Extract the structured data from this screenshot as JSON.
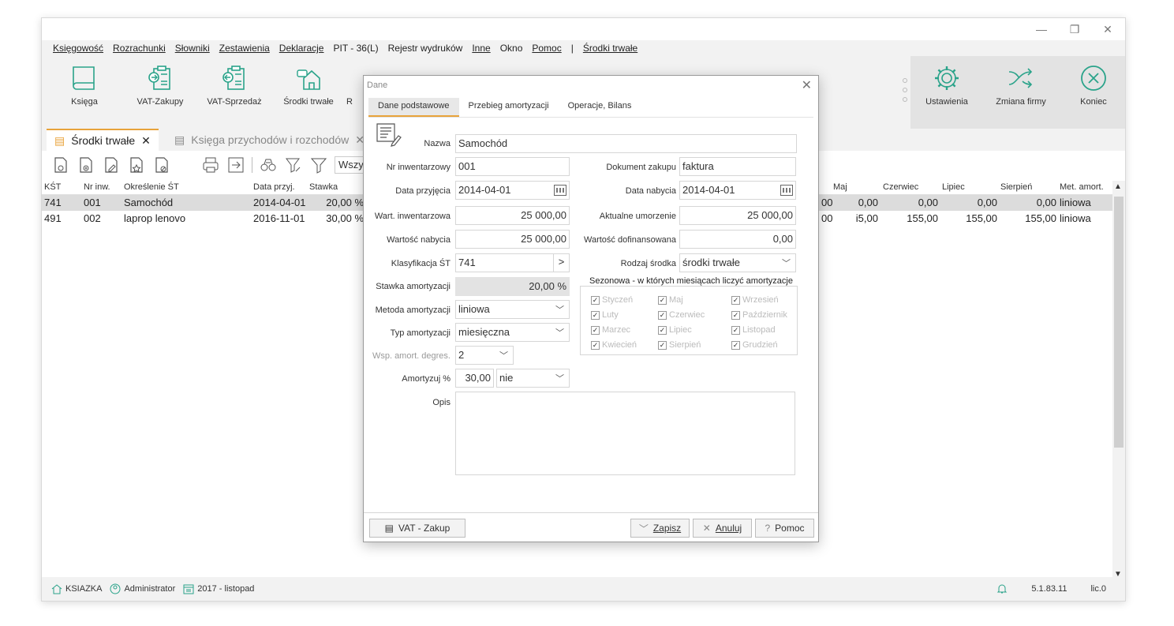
{
  "window_controls": {
    "minimize": "—",
    "restore": "❐",
    "close": "✕"
  },
  "menu": [
    "Księgowość",
    "Rozrachunki",
    "Słowniki",
    "Zestawienia",
    "Deklaracje",
    "PIT - 36(L)",
    "Rejestr wydruków",
    "Inne",
    "Okno",
    "Pomoc",
    "|",
    "Środki trwałe"
  ],
  "ribbon": {
    "ksiega": "Księga",
    "vat_zakupy": "VAT-Zakupy",
    "vat_sprzedaz": "VAT-Sprzedaż",
    "srodki_trwale": "Środki trwałe",
    "r_partial": "R",
    "ustawienia": "Ustawienia",
    "zmiana_firmy": "Zmiana firmy",
    "koniec": "Koniec"
  },
  "tabs": {
    "tab1": "Środki trwałe",
    "tab2": "Księga przychodów i rozchodów",
    "close": "✕"
  },
  "toolbar": {
    "search_value": "Wszys"
  },
  "grid": {
    "headers": {
      "kst": "KŚT",
      "nr": "Nr inw.",
      "okr": "Określenie ŚT",
      "data": "Data przyj.",
      "stawka": "Stawka",
      "maj": "Maj",
      "czerwiec": "Czerwiec",
      "lipiec": "Lipiec",
      "sierpien": "Sierpień",
      "met": "Met. amort."
    },
    "rows": [
      {
        "kst": "741",
        "nr": "001",
        "okr": "Samochód",
        "data": "2014-04-01",
        "stawka": "20,00 %",
        "prev": "00",
        "maj": "0,00",
        "czerwiec": "0,00",
        "lipiec": "0,00",
        "sierpien": "0,00",
        "met": "liniowa"
      },
      {
        "kst": "491",
        "nr": "002",
        "okr": "laprop lenovo",
        "data": "2016-11-01",
        "stawka": "30,00 %",
        "prev": "00",
        "maj": "i5,00",
        "czerwiec": "155,00",
        "lipiec": "155,00",
        "sierpien": "155,00",
        "met": "liniowa"
      }
    ]
  },
  "status": {
    "firma": "KSIAZKA",
    "user": "Administrator",
    "okres": "2017 - listopad",
    "version": "5.1.83.11",
    "lic": "lic.0"
  },
  "dialog": {
    "title": "Dane",
    "tabs": [
      "Dane podstawowe",
      "Przebieg amortyzacji",
      "Operacje, Bilans"
    ],
    "labels": {
      "nazwa": "Nazwa",
      "nr_inw": "Nr inwentarzowy",
      "data_przyjecia": "Data przyjęcia",
      "wart_inw": "Wart. inwentarzowa",
      "wart_nabycia": "Wartość nabycia",
      "klasyfikacja": "Klasyfikacja ŚT",
      "stawka": "Stawka amortyzacji",
      "metoda": "Metoda amortyzacji",
      "typ": "Typ amortyzacji",
      "wsp": "Wsp. amort. degres.",
      "amortyzuj": "Amortyzuj %",
      "opis": "Opis",
      "dokument": "Dokument zakupu",
      "data_nabycia": "Data nabycia",
      "aktualne": "Aktualne umorzenie",
      "dofinans": "Wartość dofinansowana",
      "rodzaj": "Rodzaj środka"
    },
    "values": {
      "nazwa": "Samochód",
      "nr_inw": "001",
      "data_przyjecia": "2014-04-01",
      "wart_inw": "25 000,00",
      "wart_nabycia": "25 000,00",
      "klasyfikacja": "741",
      "stawka": "20,00 %",
      "metoda": "liniowa",
      "typ": "miesięczna",
      "wsp": "2",
      "amortyzuj_pct": "30,00",
      "amortyzuj_opt": "nie",
      "dokument": "faktura",
      "data_nabycia": "2014-04-01",
      "aktualne": "25 000,00",
      "dofinans": "0,00",
      "rodzaj": "środki trwałe"
    },
    "season_title": "Sezonowa - w których miesiącach liczyć amortyzacje",
    "months": [
      "Styczeń",
      "Maj",
      "Wrzesień",
      "Luty",
      "Czerwiec",
      "Październik",
      "Marzec",
      "Lipiec",
      "Listopad",
      "Kwiecień",
      "Sierpień",
      "Grudzień"
    ],
    "buttons": {
      "vat_zakup": "VAT - Zakup",
      "zapisz": "Zapisz",
      "anuluj": "Anuluj",
      "pomoc": "Pomoc"
    }
  }
}
